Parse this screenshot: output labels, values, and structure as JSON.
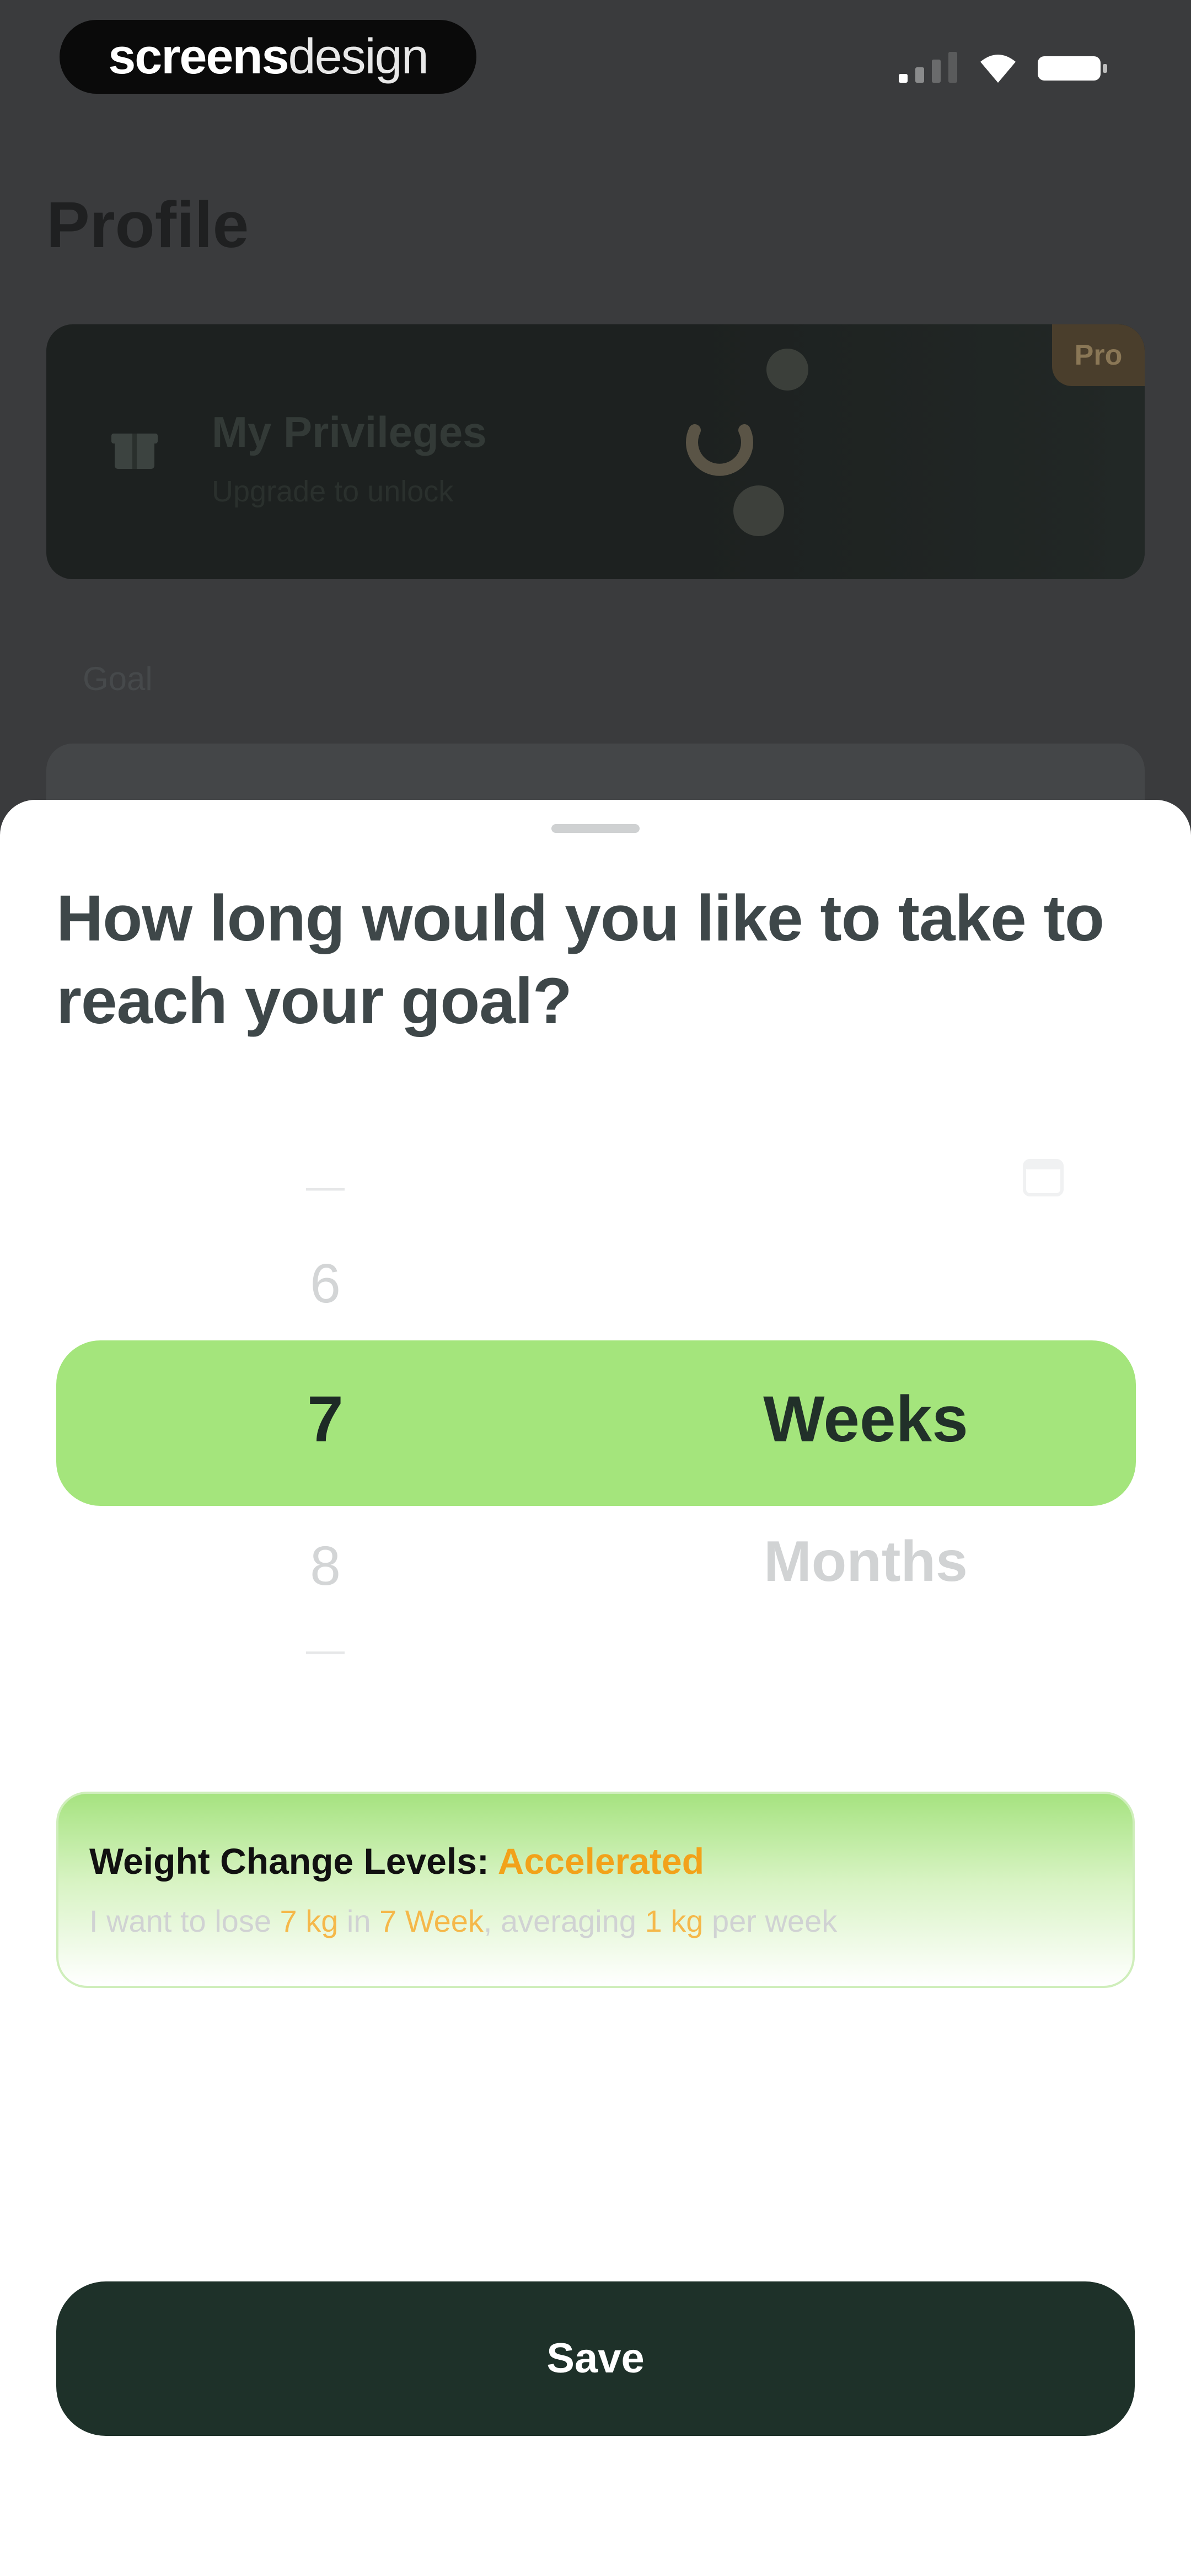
{
  "status_bar": {
    "brand_bold": "screens",
    "brand_light": "design"
  },
  "background_screen": {
    "page_title": "Profile",
    "privileges_card": {
      "title": "My Privileges",
      "subtitle": "Upgrade to unlock",
      "badge": "Pro"
    },
    "goal_label": "Goal"
  },
  "sheet": {
    "title": "How long would you like to take to reach your goal?",
    "picker": {
      "numbers": {
        "above_far": "—",
        "above": "6",
        "selected": "7",
        "below": "8",
        "below_far": "—"
      },
      "units": {
        "selected": "Weeks",
        "below": "Months"
      }
    },
    "info": {
      "title_label": "Weight Change Levels:",
      "title_value": "Accelerated",
      "desc_parts": [
        "I want to lose ",
        "7 kg",
        " in ",
        "7 Week",
        ", averaging ",
        "1 kg",
        " per week"
      ]
    },
    "save_label": "Save"
  },
  "colors": {
    "accent_green": "#a4e57c",
    "dark_green": "#1e3129",
    "accent_orange": "#f2a21a"
  },
  "icons": [
    "signal-icon",
    "wifi-icon",
    "battery-icon",
    "gift-icon",
    "calendar-icon"
  ]
}
